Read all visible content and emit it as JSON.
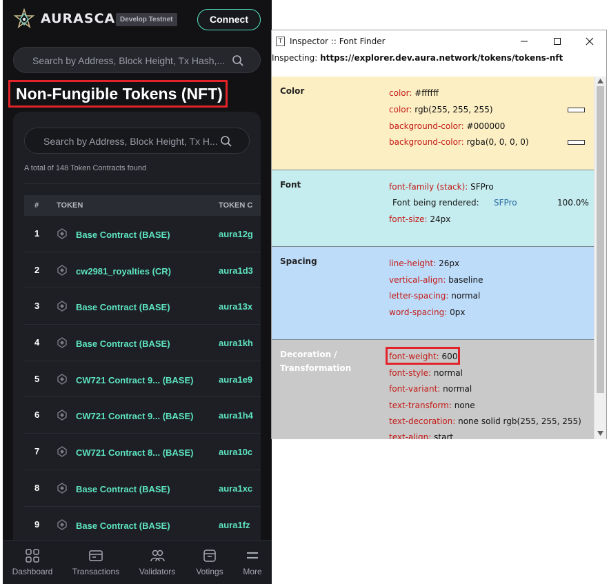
{
  "app": {
    "logo_text": "AURASCAN",
    "env_badge": "Develop Testnet",
    "connect_label": "Connect",
    "search_placeholder": "Search by Address, Block Height, Tx Hash,...",
    "page_title": "Non-Fungible Tokens (NFT)",
    "card_search_placeholder": "Search by Address, Block Height, Tx H...",
    "total_text": "A total of 148 Token Contracts found",
    "columns": [
      "#",
      "TOKEN",
      "TOKEN C"
    ],
    "rows": [
      {
        "num": "1",
        "name": "Base Contract (BASE)",
        "addr": "aura12g"
      },
      {
        "num": "2",
        "name": "cw2981_royalties (CR)",
        "addr": "aura1d3"
      },
      {
        "num": "3",
        "name": "Base Contract (BASE)",
        "addr": "aura13x"
      },
      {
        "num": "4",
        "name": "Base Contract (BASE)",
        "addr": "aura1kh"
      },
      {
        "num": "5",
        "name": "CW721 Contract 9... (BASE)",
        "addr": "aura1e9"
      },
      {
        "num": "6",
        "name": "CW721 Contract 9... (BASE)",
        "addr": "aura1h4"
      },
      {
        "num": "7",
        "name": "CW721 Contract 8... (BASE)",
        "addr": "aura10c"
      },
      {
        "num": "8",
        "name": "Base Contract (BASE)",
        "addr": "aura1xc"
      },
      {
        "num": "9",
        "name": "Base Contract (BASE)",
        "addr": "aura1fz"
      }
    ],
    "nav": [
      {
        "label": "Dashboard",
        "icon": "grid-icon"
      },
      {
        "label": "Transactions",
        "icon": "transactions-icon"
      },
      {
        "label": "Validators",
        "icon": "validators-icon"
      },
      {
        "label": "Votings",
        "icon": "votings-icon"
      },
      {
        "label": "More",
        "icon": "menu-icon"
      }
    ],
    "colors": {
      "accent": "#5ee6c0",
      "background": "#121214",
      "highlight": "#e2232a"
    }
  },
  "inspector": {
    "title": "Inspector :: Font Finder",
    "inspecting_label": "Inspecting:",
    "url": "https://explorer.dev.aura.network/tokens/tokens-nft",
    "color": {
      "heading": "Color",
      "color_hex_key": "color:",
      "color_hex_val": "#ffffff",
      "color_rgb_key": "color:",
      "color_rgb_val": "rgb(255, 255, 255)",
      "bg_hex_key": "background-color:",
      "bg_hex_val": "#000000",
      "bg_rgba_key": "background-color:",
      "bg_rgba_val": "rgba(0, 0, 0, 0)",
      "bg": "#fcefc4"
    },
    "font": {
      "heading": "Font",
      "family_key": "font-family (stack):",
      "family_val": "SFPro",
      "rendered_key": "Font being rendered:",
      "rendered_val": "SFPro",
      "rendered_pct": "100.0%",
      "size_key": "font-size:",
      "size_val": "24px",
      "bg": "#c5ecef"
    },
    "spacing": {
      "heading": "Spacing",
      "lh_key": "line-height:",
      "lh_val": "26px",
      "va_key": "vertical-align:",
      "va_val": "baseline",
      "ls_key": "letter-spacing:",
      "ls_val": "normal",
      "ws_key": "word-spacing:",
      "ws_val": "0px",
      "bg": "#bddcfa"
    },
    "decoration": {
      "heading1": "Decoration /",
      "heading2": "Transformation",
      "fw_key": "font-weight:",
      "fw_val": "600",
      "fs_key": "font-style:",
      "fs_val": "normal",
      "fv_key": "font-variant:",
      "fv_val": "normal",
      "tt_key": "text-transform:",
      "tt_val": "none",
      "td_key": "text-decoration:",
      "td_val": "none solid rgb(255, 255, 255)",
      "ta_key": "text-align:",
      "ta_val": "start",
      "bg": "#c9c9c9"
    }
  }
}
